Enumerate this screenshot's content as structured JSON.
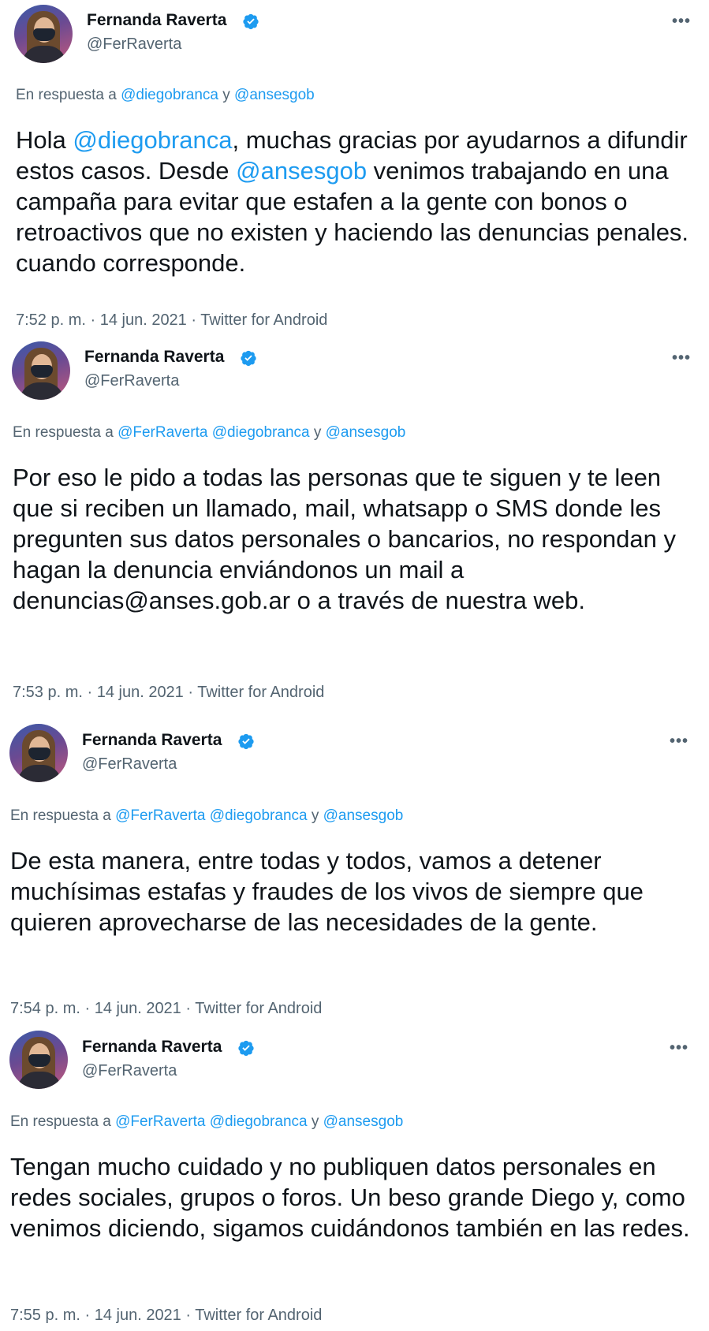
{
  "reply_prefix": "En respuesta a",
  "reply_and": "y",
  "tweets": [
    {
      "name": "Fernanda Raverta",
      "handle": "@FerRaverta",
      "more": "•••",
      "mentions": [
        "@diegobranca",
        "@ansesgob"
      ],
      "text_parts": [
        "Hola ",
        "@diegobranca",
        ", muchas gracias por ayudarnos a difundir estos casos. Desde ",
        "@ansesgob",
        " venimos trabajando en una campaña para evitar que estafen a la gente con bonos o retroactivos que no existen y haciendo las denuncias penales. cuando corresponde."
      ],
      "meta": "7:52 p. m. · 14 jun. 2021 · Twitter for Android"
    },
    {
      "name": "Fernanda Raverta",
      "handle": "@FerRaverta",
      "more": "•••",
      "mentions": [
        "@FerRaverta",
        "@diegobranca",
        "@ansesgob"
      ],
      "text": "Por eso le pido a todas las personas que te siguen y te leen que si reciben un llamado, mail, whatsapp o SMS donde les pregunten sus datos personales o bancarios, no respondan y hagan la denuncia enviándonos un mail a denuncias@anses.gob.ar o a través de nuestra web.",
      "meta": "7:53 p. m. · 14 jun. 2021 · Twitter for Android"
    },
    {
      "name": "Fernanda Raverta",
      "handle": "@FerRaverta",
      "more": "•••",
      "mentions": [
        "@FerRaverta",
        "@diegobranca",
        "@ansesgob"
      ],
      "text": "De esta manera, entre todas y todos, vamos a detener muchísimas estafas y fraudes de los vivos de siempre que quieren aprovecharse de las necesidades de la gente.",
      "meta": "7:54 p. m. · 14 jun. 2021 · Twitter for Android"
    },
    {
      "name": "Fernanda Raverta",
      "handle": "@FerRaverta",
      "more": "•••",
      "mentions": [
        "@FerRaverta",
        "@diegobranca",
        "@ansesgob"
      ],
      "text": "Tengan mucho cuidado y no publiquen datos personales en redes sociales, grupos o foros. Un beso grande Diego y, como venimos diciendo, sigamos cuidándonos también en las redes.",
      "meta": "7:55 p. m. · 14 jun. 2021 · Twitter for Android"
    }
  ],
  "colors": {
    "text": "#0f1419",
    "secondary": "#536471",
    "link": "#1d9bf0",
    "verified": "#1d9bf0"
  }
}
